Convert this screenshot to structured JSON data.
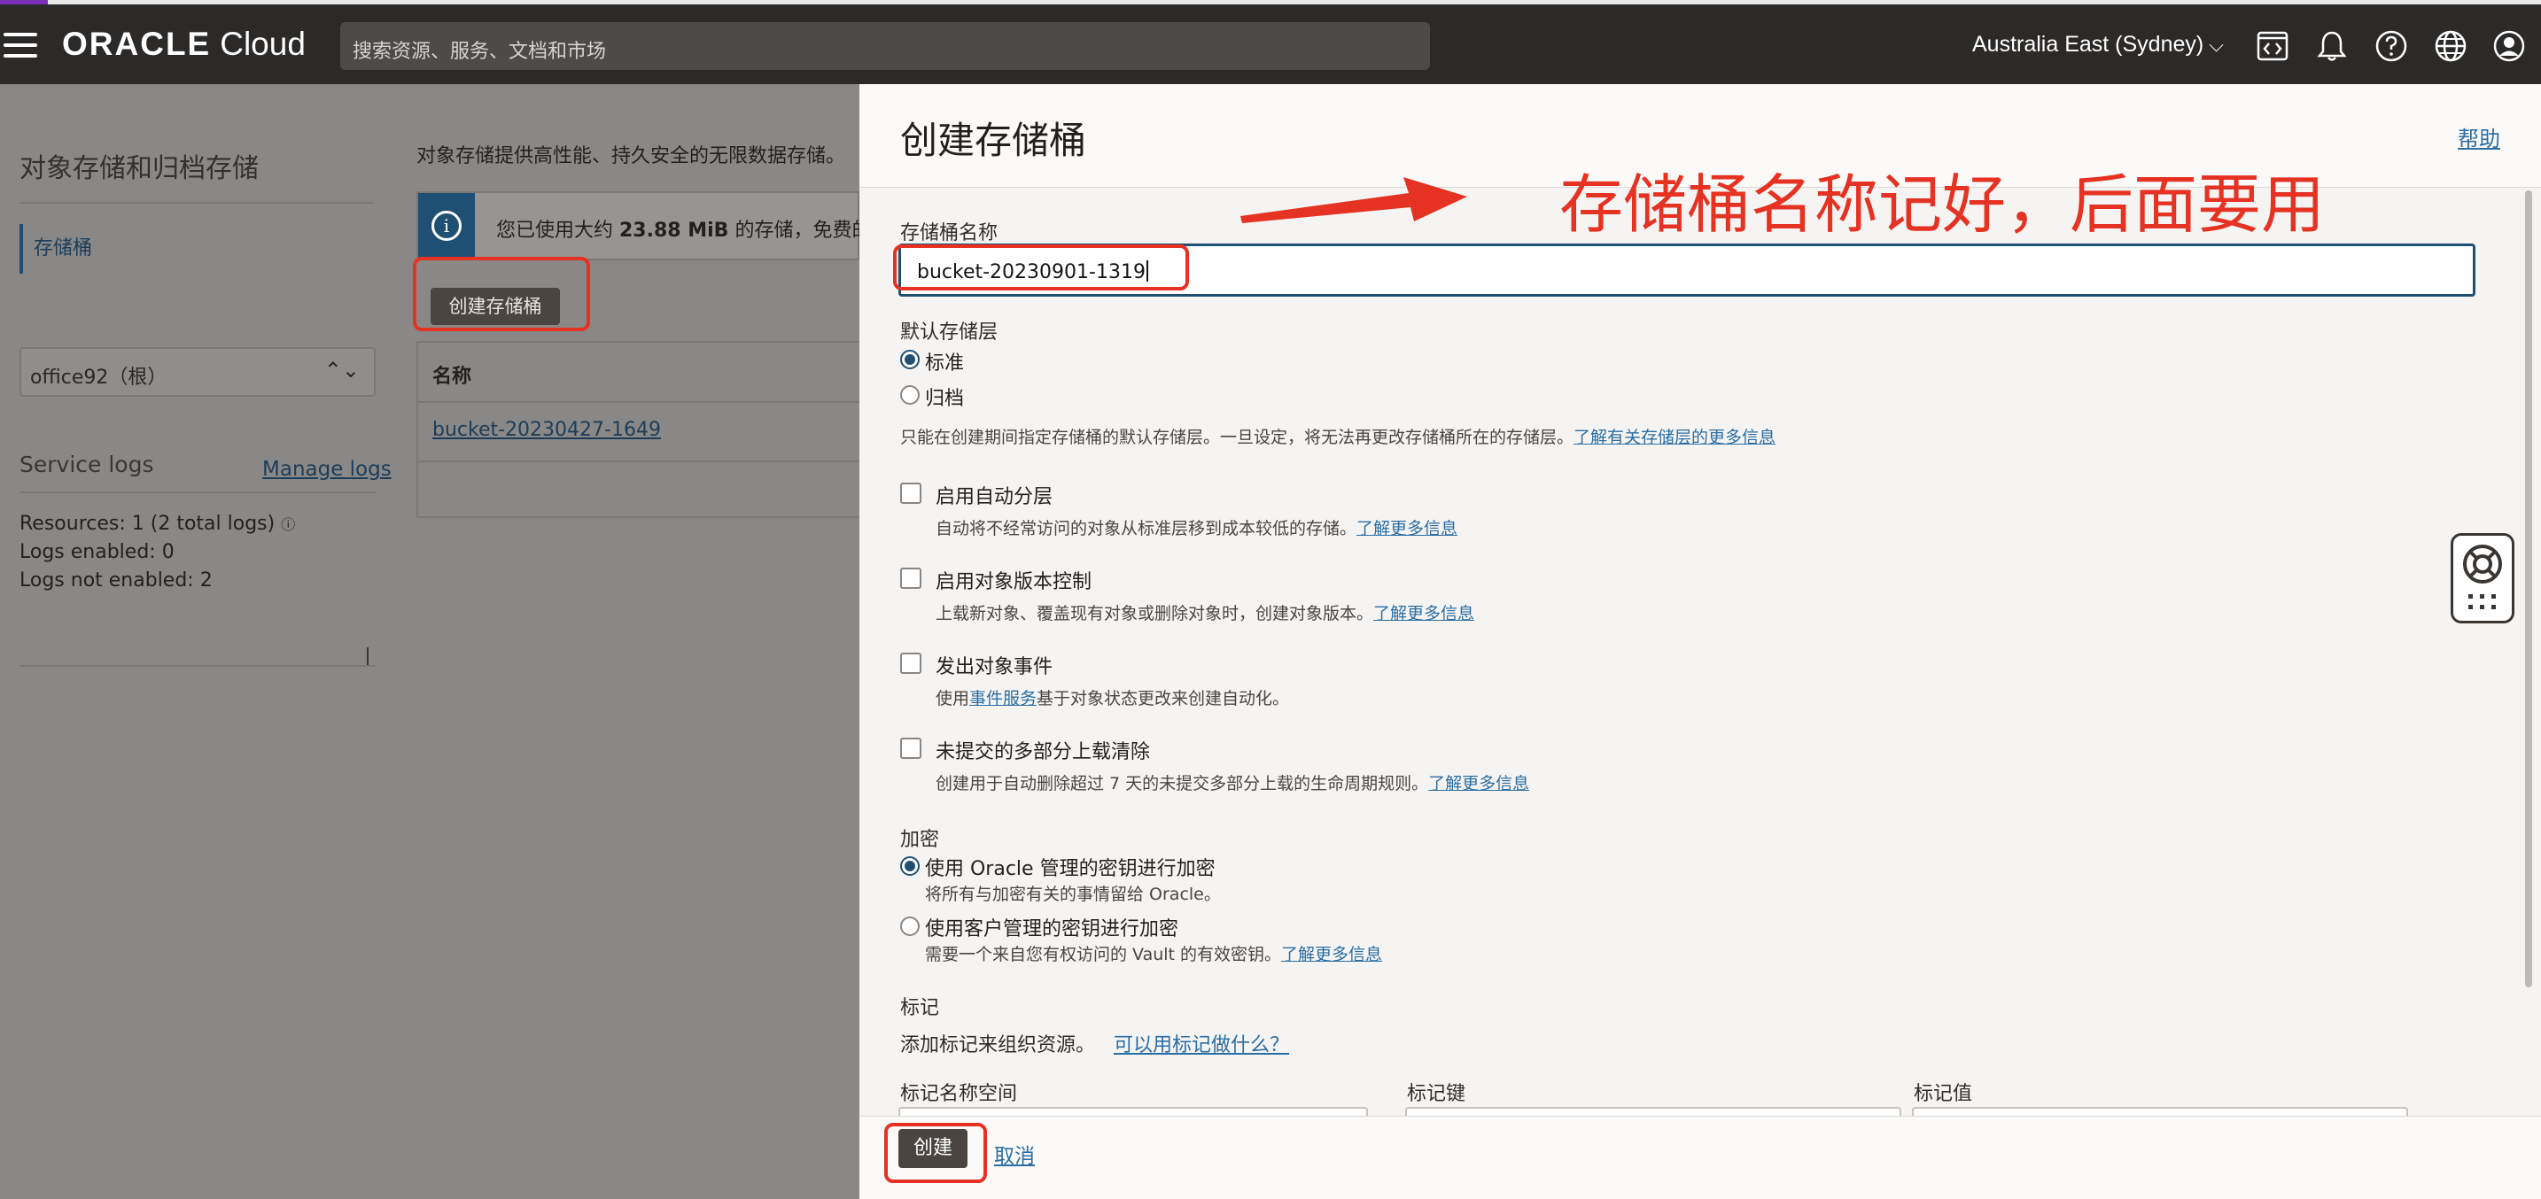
{
  "header": {
    "brand": "ORACLE",
    "brand_suffix": "Cloud",
    "search_placeholder": "搜索资源、服务、文档和市场",
    "region": "Australia East (Sydney)"
  },
  "sidebar": {
    "title": "对象存储和归档存储",
    "items": [
      {
        "label": "存储桶"
      }
    ],
    "compartment": "office92（根）",
    "service_logs_title": "Service logs",
    "manage_logs": "Manage logs",
    "resources": "Resources:  1 (2 total logs)",
    "logs_enabled": "Logs enabled:  0",
    "logs_not_enabled": "Logs not enabled:  2"
  },
  "main": {
    "intro": "对象存储提供高性能、持久安全的无限数据存储。",
    "info_prefix": "您已使用大约 ",
    "info_amount": "23.88 MiB",
    "info_suffix": " 的存储，免费的",
    "create_bucket_button": "创建存储桶",
    "table_header_name": "名称",
    "rows": [
      {
        "name": "bucket-20230427-1649"
      }
    ]
  },
  "panel": {
    "title": "创建存储桶",
    "help": "帮助",
    "bucket_name_label": "存储桶名称",
    "bucket_name_value": "bucket-20230901-1319",
    "tier_label": "默认存储层",
    "tier_standard": "标准",
    "tier_archive": "归档",
    "tier_note": "只能在创建期间指定存储桶的默认存储层。一旦设定，将无法再更改存储桶所在的存储层。",
    "tier_link": "了解有关存储层的更多信息",
    "auto_tiering_label": "启用自动分层",
    "auto_tiering_desc": "自动将不经常访问的对象从标准层移到成本较低的存储。",
    "versioning_label": "启用对象版本控制",
    "versioning_desc": "上载新对象、覆盖现有对象或删除对象时，创建对象版本。",
    "events_label": "发出对象事件",
    "events_desc_prefix": "使用",
    "events_desc_link": "事件服务",
    "events_desc_suffix": "基于对象状态更改来创建自动化。",
    "multipart_label": "未提交的多部分上载清除",
    "multipart_desc": "创建用于自动删除超过 7 天的未提交多部分上载的生命周期规则。",
    "learn_more": "了解更多信息",
    "encryption_label": "加密",
    "enc_oracle_label": "使用 Oracle 管理的密钥进行加密",
    "enc_oracle_desc": "将所有与加密有关的事情留给 Oracle。",
    "enc_customer_label": "使用客户管理的密钥进行加密",
    "enc_customer_desc": "需要一个来自您有权访问的 Vault 的有效密钥。",
    "tags_label": "标记",
    "tags_desc": "添加标记来组织资源。",
    "tags_link": "可以用标记做什么？",
    "tag_namespace": "标记名称空间",
    "tag_key": "标记键",
    "tag_value": "标记值",
    "create_button": "创建",
    "cancel_button": "取消"
  },
  "annotation": {
    "text": "存储桶名称记好，后面要用",
    "color": "#e53223"
  },
  "colors": {
    "header_bg": "#2c2a28",
    "link": "#2c6ea3",
    "accent": "#1f4f73"
  }
}
